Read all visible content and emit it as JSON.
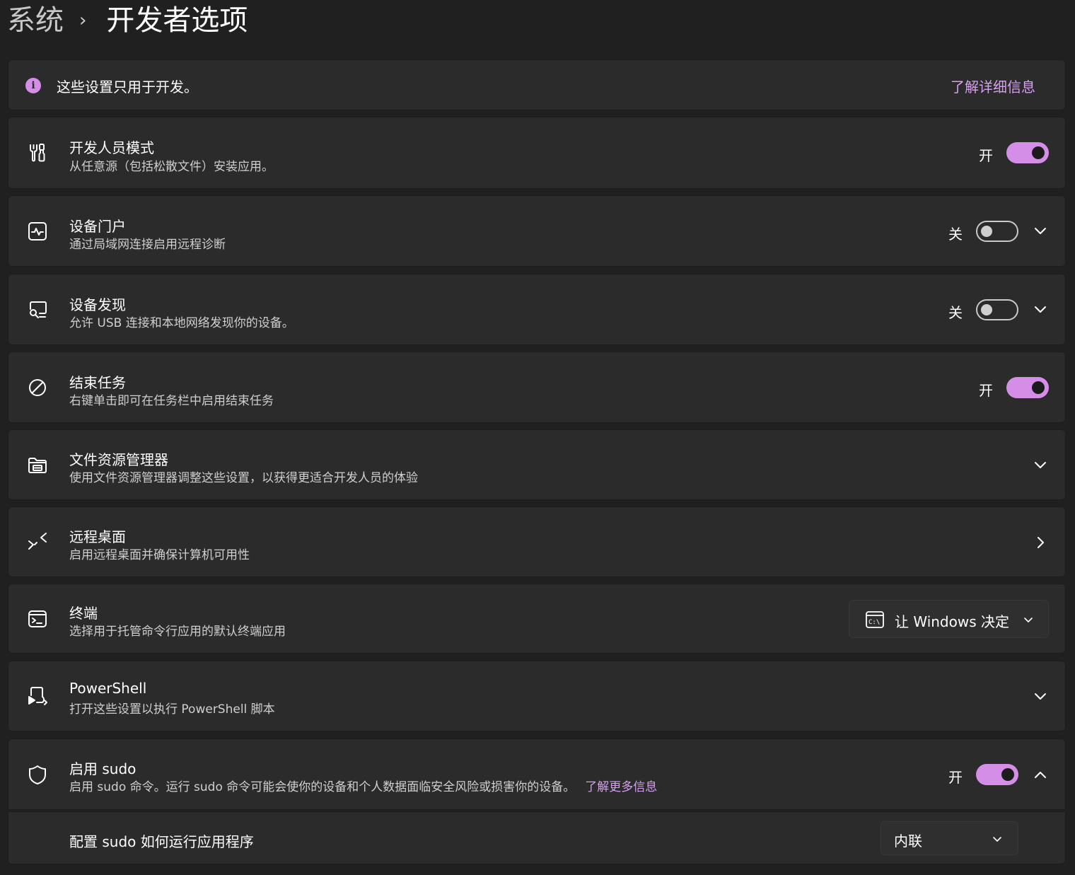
{
  "breadcrumb": {
    "parent": "系统",
    "separator": "›",
    "current": "开发者选项"
  },
  "info_banner": {
    "icon": "info-icon",
    "text": "这些设置只用于开发。",
    "link": "了解详细信息"
  },
  "settings": {
    "developer_mode": {
      "icon": "developer-tools-icon",
      "title": "开发人员模式",
      "subtitle": "从任意源（包括松散文件）安装应用。",
      "state_label": "开",
      "enabled": true
    },
    "device_portal": {
      "icon": "device-portal-icon",
      "title": "设备门户",
      "subtitle": "通过局域网连接启用远程诊断",
      "state_label": "关",
      "enabled": false
    },
    "device_discovery": {
      "icon": "device-discovery-icon",
      "title": "设备发现",
      "subtitle": "允许 USB 连接和本地网络发现你的设备。",
      "state_label": "关",
      "enabled": false
    },
    "end_task": {
      "icon": "end-task-icon",
      "title": "结束任务",
      "subtitle": "右键单击即可在任务栏中启用结束任务",
      "state_label": "开",
      "enabled": true
    },
    "file_explorer": {
      "icon": "file-explorer-icon",
      "title": "文件资源管理器",
      "subtitle": "使用文件资源管理器调整这些设置，以获得更适合开发人员的体验"
    },
    "remote_desktop": {
      "icon": "remote-desktop-icon",
      "title": "远程桌面",
      "subtitle": "启用远程桌面并确保计算机可用性"
    },
    "terminal": {
      "icon": "terminal-icon",
      "title": "终端",
      "subtitle": "选择用于托管命令行应用的默认终端应用",
      "dropdown_icon": "command-prompt-icon",
      "dropdown_value": "让 Windows 决定"
    },
    "powershell": {
      "icon": "powershell-icon",
      "title": "PowerShell",
      "subtitle": "打开这些设置以执行 PowerShell 脚本"
    },
    "sudo": {
      "icon": "shield-icon",
      "title": "启用 sudo",
      "subtitle": "启用 sudo 命令。运行 sudo 命令可能会使你的设备和个人数据面临安全风险或损害你的设备。",
      "link": "了解更多信息",
      "state_label": "开",
      "enabled": true,
      "config_label": "配置 sudo 如何运行应用程序",
      "config_value": "内联"
    }
  },
  "colors": {
    "accent": "#d58ee8",
    "link": "#d4a0ef",
    "background": "#202020",
    "card": "#2b2b2b"
  }
}
